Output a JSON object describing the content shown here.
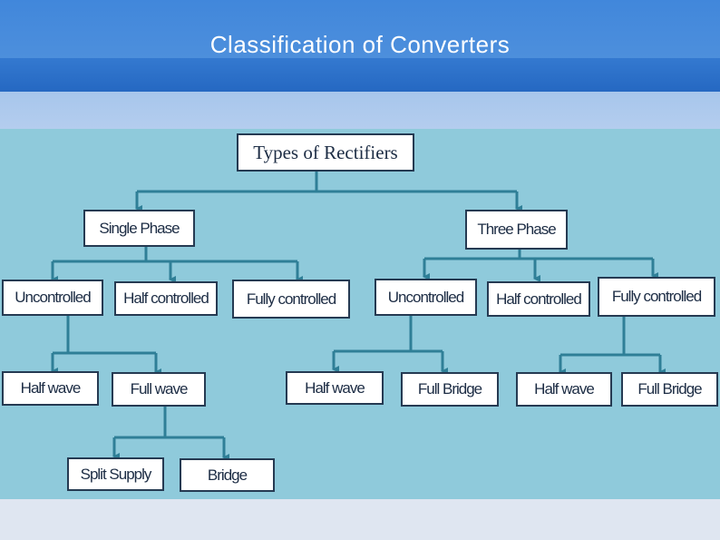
{
  "slide": {
    "title": "Classification of Converters"
  },
  "colors": {
    "header_blue": "#4187db",
    "canvas_teal": "#8fcadb",
    "connector": "#2f7f97",
    "node_border": "#253a52",
    "node_text": "#1c2c44"
  },
  "tree": {
    "root": "Types of Rectifiers",
    "single_phase": {
      "label": "Single Phase",
      "uncontrolled": "Uncontrolled",
      "half_controlled": "Half controlled",
      "fully_controlled": "Fully controlled",
      "half_wave": "Half wave",
      "full_wave": "Full wave",
      "split_supply": "Split Supply",
      "bridge": "Bridge"
    },
    "three_phase": {
      "label": "Three Phase",
      "uncontrolled": "Uncontrolled",
      "half_controlled": "Half controlled",
      "fully_controlled": "Fully controlled",
      "unc_half_wave": "Half wave",
      "unc_full_bridge": "Full Bridge",
      "fc_half_wave": "Half wave",
      "fc_full_bridge": "Full Bridge"
    }
  }
}
